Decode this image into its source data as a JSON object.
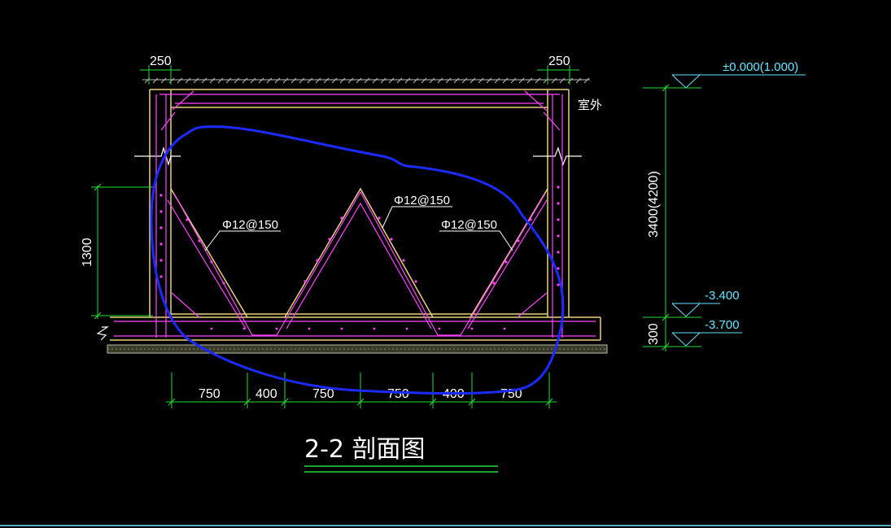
{
  "drawing": {
    "title": "2-2 剖面图",
    "outdoor_label": "室外",
    "top_dims": [
      "250",
      "250"
    ],
    "left_dim": "1300",
    "right_dim_main": "3400(4200)",
    "right_dim_small": "300",
    "elevations": [
      "±0.000(1.000)",
      "-3.400",
      "-3.700"
    ],
    "rebar_labels": [
      "Φ12@150",
      "Φ12@150",
      "Φ12@150"
    ],
    "bottom_dims": [
      "750",
      "400",
      "750",
      "750",
      "400",
      "750"
    ]
  },
  "colors": {
    "background": "#000000",
    "wall_outline": "#e8d37a",
    "rebar": "#ff44ff",
    "dimension": "#22dd33",
    "annotation": "#66e6ff",
    "markup": "#1b2bff"
  }
}
